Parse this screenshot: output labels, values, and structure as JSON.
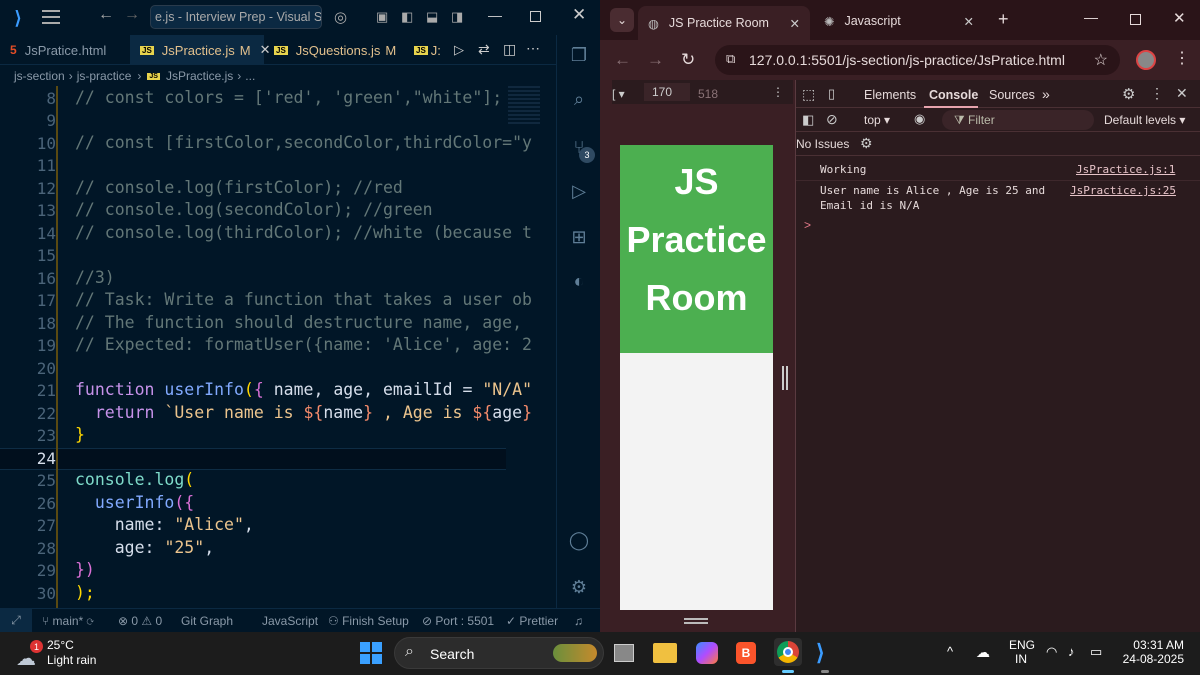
{
  "vscode": {
    "title": "e.js - Interview Prep - Visual Studi",
    "tabs": [
      {
        "label": "JsPratice.html",
        "modified": ""
      },
      {
        "label": "JsPractice.js",
        "modified": "M"
      },
      {
        "label": "JsQuestions.js",
        "modified": "M"
      },
      {
        "label": "J:",
        "modified": ""
      }
    ],
    "breadcrumb": [
      "js-section",
      "js-practice",
      "JsPractice.js",
      "..."
    ],
    "line_numbers": [
      "8",
      "9",
      "10",
      "11",
      "12",
      "13",
      "14",
      "15",
      "16",
      "17",
      "18",
      "19",
      "20",
      "21",
      "22",
      "23",
      "24",
      "25",
      "26",
      "27",
      "28",
      "29",
      "30"
    ],
    "current_line": "24",
    "code": {
      "l8": "// const colors = ['red', 'green',\"white\"];",
      "l10": "// const [firstColor,secondColor,thirdColor=\"y",
      "l12": "// console.log(firstColor); //red",
      "l13": "// console.log(secondColor); //green",
      "l14": "// console.log(thirdColor); //white (because t",
      "l16": "//3)",
      "l17": "// Task: Write a function that takes a user ob",
      "l18": "// The function should destructure name, age,",
      "l19": "// Expected: formatUser({name: 'Alice', age: 2",
      "l21_kw": "function",
      "l21_fn": "userInfo",
      "l21_a": "(",
      "l21_b": "{",
      "l21_c": " name, age, emailId = ",
      "l21_d": "\"N/A\"",
      "l22_kw": "return",
      "l22_a": "`User name is ",
      "l22_b": "${",
      "l22_c": "name",
      "l22_d": "}",
      "l22_e": " , Age is ",
      "l22_f": "${",
      "l22_g": "age",
      "l22_h": "}",
      "l23": "}",
      "l25_a": "console.log",
      "l25_b": "(",
      "l26_a": "userInfo",
      "l26_b": "({",
      "l27_a": "name:",
      "l27_b": "\"Alice\"",
      "l27_c": ",",
      "l28_a": "age:",
      "l28_b": "\"25\"",
      "l28_c": ",",
      "l29": "})",
      "l30": ");"
    },
    "scm_badge": "3",
    "status": {
      "branch": "main*",
      "errors": "0",
      "warnings": "0",
      "git_graph": "Git Graph",
      "language": "JavaScript",
      "finish_setup": "Finish Setup",
      "port": "Port : 5501",
      "prettier": "Prettier"
    }
  },
  "chrome": {
    "tabs": [
      {
        "label": "JS Practice Room"
      },
      {
        "label": "Javascript"
      }
    ],
    "url": "127.0.0.1:5501/js-section/js-practice/JsPratice.html",
    "page_heading_lines": [
      "JS",
      "Practice",
      "Room"
    ],
    "page_heading_color": "#4caf50",
    "devtools": {
      "width_val": "170",
      "height_val": "518",
      "tabs": [
        "Elements",
        "Console",
        "Sources"
      ],
      "active_tab": "Console",
      "context": "top",
      "filter_placeholder": "Filter",
      "levels": "Default levels",
      "issues": "No Issues",
      "logs": [
        {
          "text": "Working",
          "source": "JsPractice.js:1"
        },
        {
          "text": "User name is Alice , Age is 25 and",
          "text2": "Email id is N/A",
          "source": "JsPractice.js:25"
        }
      ],
      "prompt": ">"
    }
  },
  "taskbar": {
    "temp": "25°C",
    "weather": "Light rain",
    "weather_badge": "1",
    "search": "Search",
    "lang1": "ENG",
    "lang2": "IN",
    "time": "03:31 AM",
    "date": "24-08-2025"
  }
}
